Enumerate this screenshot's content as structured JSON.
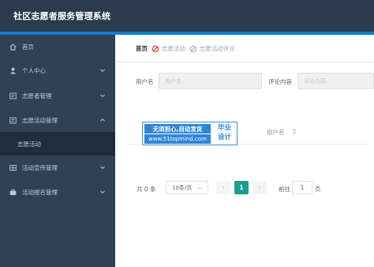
{
  "app": {
    "title": "社区志愿者服务管理系统"
  },
  "sidebar": {
    "items": [
      {
        "label": "首页",
        "icon": "home-icon"
      },
      {
        "label": "个人中心",
        "icon": "user-icon"
      },
      {
        "label": "志愿者管理",
        "icon": "list-icon"
      },
      {
        "label": "志愿活动管理",
        "icon": "list-icon",
        "expanded": true
      },
      {
        "label": "志愿活动",
        "sub": true
      },
      {
        "label": "活动宣传管理",
        "icon": "grid-icon"
      },
      {
        "label": "活动报名管理",
        "icon": "briefcase-icon"
      }
    ]
  },
  "breadcrumb": {
    "home": "首页",
    "items": [
      "志愿活动",
      "志愿活动评论"
    ]
  },
  "search": {
    "user_label": "用户名",
    "user_placeholder": "用户名",
    "comment_label": "评论内容",
    "comment_placeholder": "评论内容"
  },
  "table": {
    "columns": [
      "用户名"
    ]
  },
  "watermark": {
    "line1": "无须担心,自动发货",
    "url": "www.51topmind.com",
    "side1": "毕业",
    "side2": "设计"
  },
  "pagination": {
    "total": "共 0 条",
    "page_size": "10条/页",
    "prev": "‹",
    "current": "1",
    "next": "›",
    "goto_label": "前往",
    "goto_value": "1",
    "page_suffix": "页"
  },
  "colors": {
    "header_bg": "#2b3a4d",
    "accent": "#0e7fd1",
    "sidebar_bg": "#304156",
    "active_page": "#1a9e8f"
  }
}
